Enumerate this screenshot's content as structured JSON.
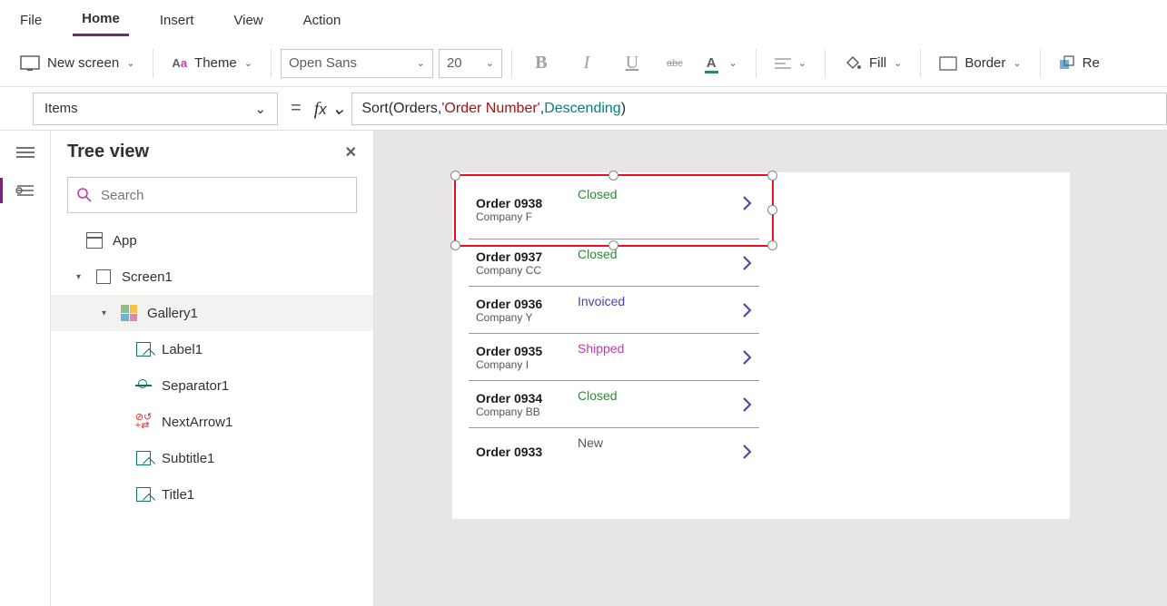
{
  "menu": {
    "file": "File",
    "home": "Home",
    "insert": "Insert",
    "view": "View",
    "action": "Action"
  },
  "ribbon": {
    "new_screen": "New screen",
    "theme": "Theme",
    "font_name": "Open Sans",
    "font_size": "20",
    "fill": "Fill",
    "border": "Border",
    "reorder": "Re"
  },
  "formula": {
    "property": "Items",
    "tokens": {
      "fn": "Sort",
      "lp": "( ",
      "id": "Orders",
      "c1": ", ",
      "str": "'Order Number'",
      "c2": ", ",
      "kw": "Descending",
      "rp": " )"
    }
  },
  "treeview": {
    "title": "Tree view",
    "search_placeholder": "Search",
    "nodes": {
      "app": "App",
      "screen1": "Screen1",
      "gallery1": "Gallery1",
      "label1": "Label1",
      "separator1": "Separator1",
      "nextarrow1": "NextArrow1",
      "subtitle1": "Subtitle1",
      "title1": "Title1"
    }
  },
  "gallery": [
    {
      "title": "Order 0938",
      "subtitle": "Company F",
      "status": "Closed",
      "status_class": "st-closed"
    },
    {
      "title": "Order 0937",
      "subtitle": "Company CC",
      "status": "Closed",
      "status_class": "st-closed"
    },
    {
      "title": "Order 0936",
      "subtitle": "Company Y",
      "status": "Invoiced",
      "status_class": "st-invoiced"
    },
    {
      "title": "Order 0935",
      "subtitle": "Company I",
      "status": "Shipped",
      "status_class": "st-shipped"
    },
    {
      "title": "Order 0934",
      "subtitle": "Company BB",
      "status": "Closed",
      "status_class": "st-closed"
    },
    {
      "title": "Order 0933",
      "subtitle": "",
      "status": "New",
      "status_class": "st-new"
    }
  ]
}
